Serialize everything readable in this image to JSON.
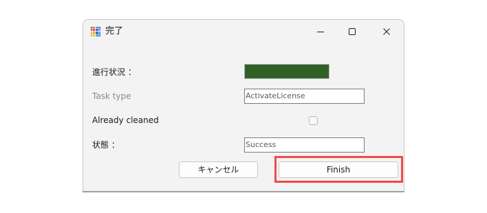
{
  "window": {
    "title": "完了",
    "app_icon": "winforms-app-icon",
    "controls": {
      "minimize_icon": "minimize-icon",
      "maximize_icon": "maximize-icon",
      "close_icon": "close-icon"
    }
  },
  "form": {
    "progress_label": "進行状況 ：",
    "progress_fill_fraction": 1.0,
    "progress_color": "#2f6127",
    "task_type_label": "Task type",
    "task_type_value": "ActivateLicense",
    "already_cleaned_label": "Already cleaned",
    "already_cleaned_checked": false,
    "status_label": "状態 ：",
    "status_value": "Success"
  },
  "buttons": {
    "cancel_label": "キャンセル",
    "finish_label": "Finish"
  },
  "annotation": {
    "highlight_color": "#ef4b45",
    "highlight_target": "finish-button"
  }
}
